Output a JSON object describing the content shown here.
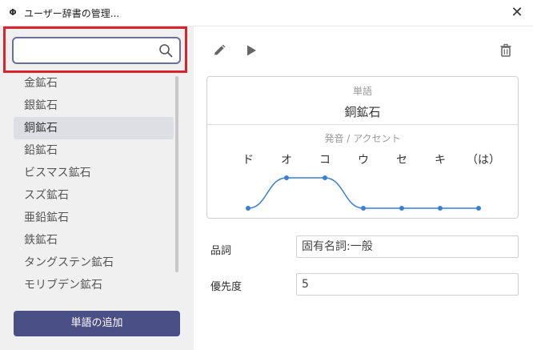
{
  "window": {
    "title": "ユーザー辞書の管理...",
    "app_icon": "Φ"
  },
  "search": {
    "value": "",
    "placeholder": ""
  },
  "word_list": {
    "items": [
      "金鉱石",
      "銀鉱石",
      "銅鉱石",
      "鉛鉱石",
      "ビスマス鉱石",
      "スズ鉱石",
      "亜鉛鉱石",
      "鉄鉱石",
      "タングステン鉱石",
      "モリブデン鉱石"
    ],
    "selected_index": 2
  },
  "add_button_label": "単語の追加",
  "editor": {
    "word_label": "単語",
    "word": "銅鉱石",
    "pronunciation_label": "発音 / アクセント",
    "kana": [
      "ド",
      "オ",
      "コ",
      "ウ",
      "セ",
      "キ",
      "（は）"
    ],
    "pitch": [
      0,
      1,
      1,
      0,
      0,
      0,
      0
    ]
  },
  "fields": {
    "pos_label": "品詞",
    "pos_value": "固有名詞:一般",
    "priority_label": "優先度",
    "priority_value": "5"
  },
  "colors": {
    "accent": "#4a5086",
    "pitch_line": "#3a7fd5",
    "highlight": "#d9232d"
  },
  "icons": [
    "close-icon",
    "search-icon",
    "pencil-icon",
    "play-icon",
    "trash-icon"
  ]
}
